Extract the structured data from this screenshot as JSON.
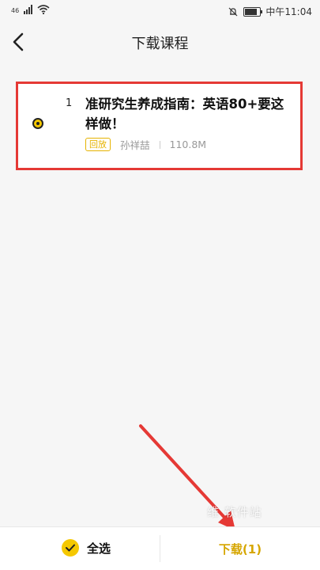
{
  "status_bar": {
    "signal_text": "46",
    "clock": "中午11:04",
    "icons": [
      "signal-icon",
      "wifi-icon",
      "bell-off-icon",
      "battery-icon"
    ]
  },
  "header": {
    "title": "下载课程"
  },
  "courses": [
    {
      "index": "1",
      "title": "准研究生养成指南：英语80+要这样做！",
      "badge": "回放",
      "teacher": "孙祥喆",
      "size": "110.8M",
      "selected": true
    }
  ],
  "bottom_bar": {
    "select_all_label": "全选",
    "download_label": "下载(1)"
  },
  "watermark": "维 软件站",
  "colors": {
    "accent": "#f5c800",
    "download_text": "#d6a600",
    "highlight_red": "#e53935"
  }
}
